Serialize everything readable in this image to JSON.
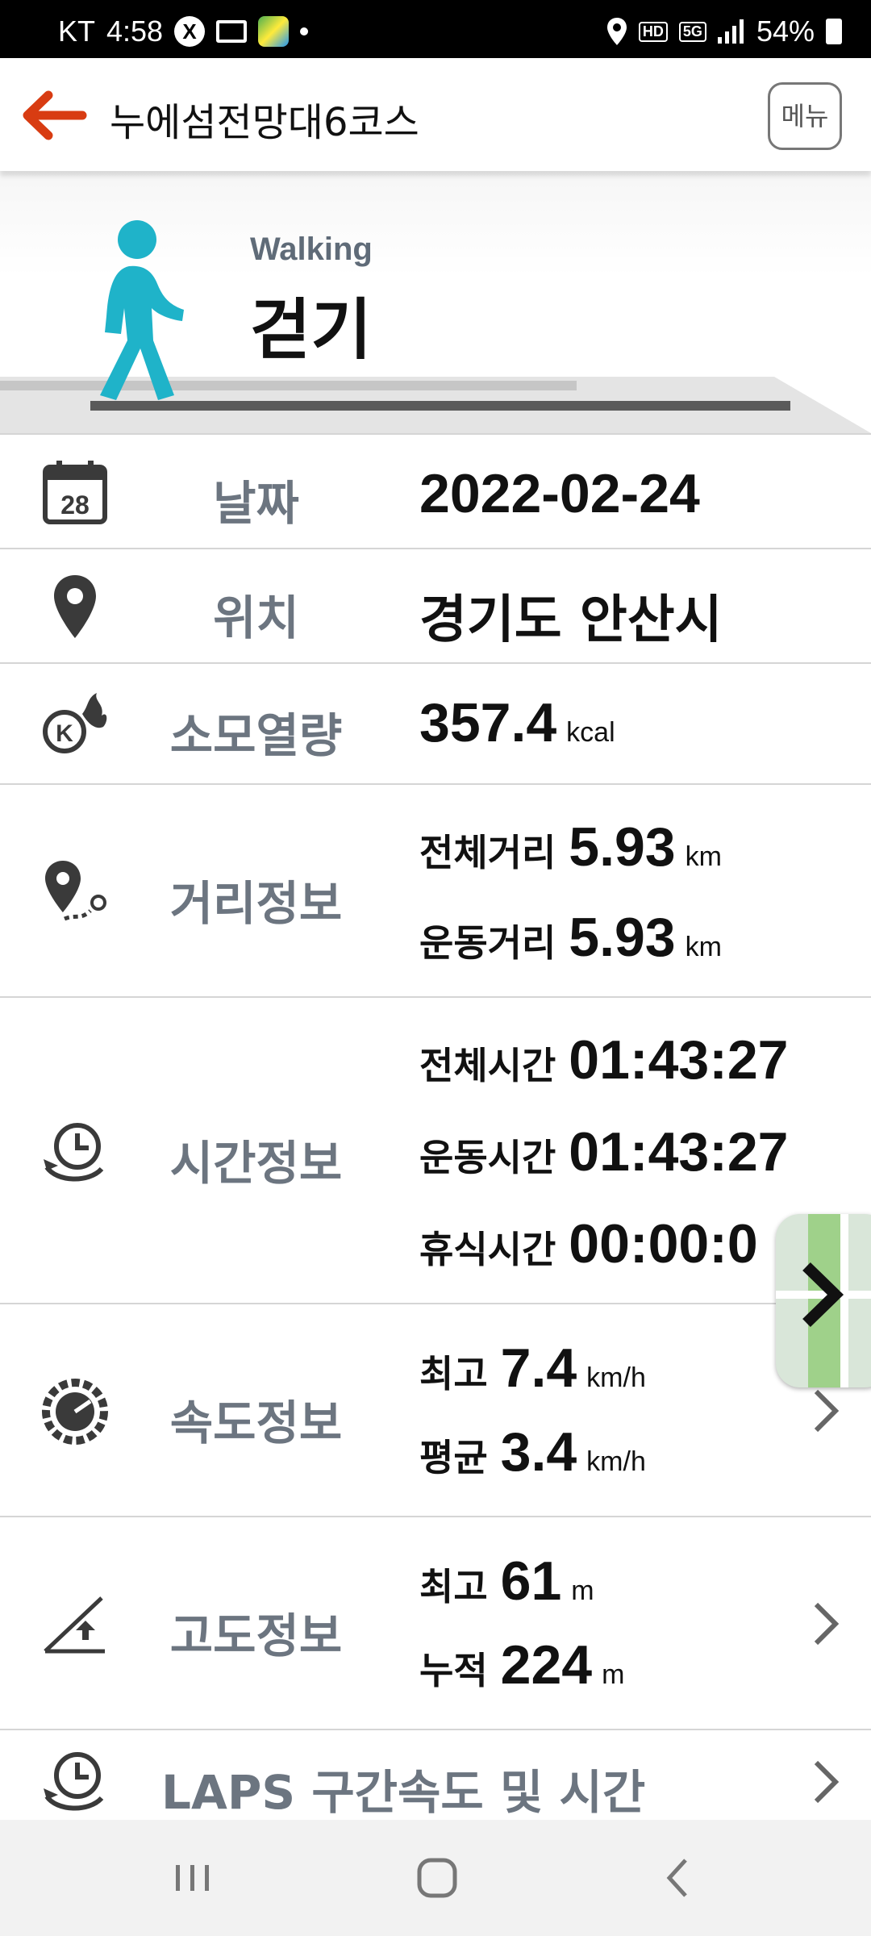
{
  "status_bar": {
    "carrier": "KT",
    "time": "4:58",
    "hd": "HD",
    "network": "5G",
    "battery": "54%"
  },
  "app_bar": {
    "title": "누에섬전망대6코스",
    "menu_label": "메뉴"
  },
  "hero": {
    "activity_en": "Walking",
    "activity_ko": "걷기"
  },
  "rows": {
    "date": {
      "label": "날짜",
      "value": "2022-02-24",
      "calendar_day": "28"
    },
    "location": {
      "label": "위치",
      "value": "경기도 안산시"
    },
    "calories": {
      "label": "소모열량",
      "value": "357.4",
      "unit": "kcal"
    },
    "distance": {
      "label": "거리정보",
      "total_label": "전체거리",
      "total_value": "5.93",
      "total_unit": "km",
      "moving_label": "운동거리",
      "moving_value": "5.93",
      "moving_unit": "km"
    },
    "time": {
      "label": "시간정보",
      "total_label": "전체시간",
      "total_value": "01:43:27",
      "moving_label": "운동시간",
      "moving_value": "01:43:27",
      "rest_label": "휴식시간",
      "rest_value": "00:00:0"
    },
    "speed": {
      "label": "속도정보",
      "max_label": "최고",
      "max_value": "7.4",
      "max_unit": "km/h",
      "avg_label": "평균",
      "avg_value": "3.4",
      "avg_unit": "km/h"
    },
    "altitude": {
      "label": "고도정보",
      "max_label": "최고",
      "max_value": "61",
      "max_unit": "m",
      "cum_label": "누적",
      "cum_value": "224",
      "cum_unit": "m"
    },
    "laps": {
      "label": "LAPS 구간속도 및 시간"
    }
  },
  "icons": {
    "back": "arrow-left-icon",
    "date": "calendar-icon",
    "location": "map-pin-icon",
    "calories": "kcal-flame-icon",
    "distance": "route-pin-icon",
    "time": "clock-cycle-icon",
    "speed": "speedometer-icon",
    "altitude": "slope-up-icon",
    "laps": "clock-cycle-icon",
    "chevron": "chevron-right-icon"
  },
  "colors": {
    "accent": "#d83c12",
    "figure": "#1fb3c9",
    "label_gray": "#6c7580",
    "icon_dark": "#3a3a3a"
  }
}
